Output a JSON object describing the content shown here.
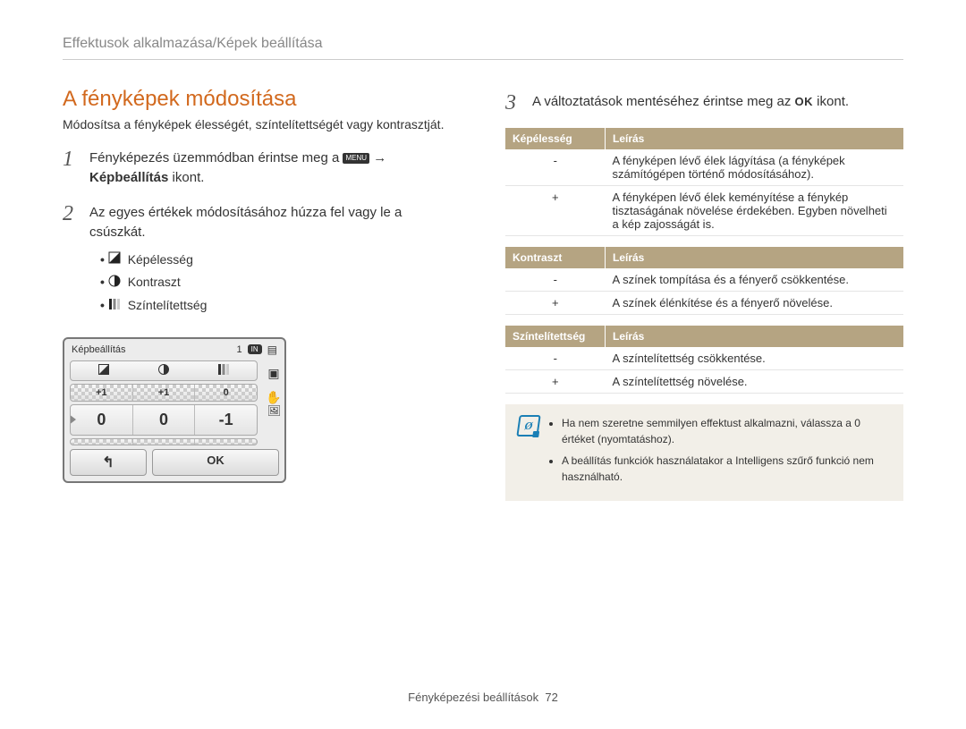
{
  "breadcrumb": "Effektusok alkalmazása/Képek beállítása",
  "title": "A fényképek módosítása",
  "intro": "Módosítsa a fényképek élességét, színtelítettségét vagy kontrasztját.",
  "steps": {
    "s1_pre": "Fényképezés üzemmódban érintse meg a ",
    "s1_menu": "MENU",
    "s1_arrow": " →",
    "s1_post_bold": "Képbeállítás",
    "s1_post_after": " ikont.",
    "s2": "Az egyes értékek módosításához húzza fel vagy le a csúszkát.",
    "s3_pre": "A változtatások mentéséhez érintse meg az ",
    "s3_ok": "OK",
    "s3_post": " ikont."
  },
  "bullets": {
    "b1": "Képélesség",
    "b2": "Kontraszt",
    "b3": "Színtelítettség"
  },
  "shot": {
    "title": "Képbeállítás",
    "counter": "1",
    "pill": "IN",
    "r1": [
      "+1",
      "+1",
      "0"
    ],
    "r2": [
      "0",
      "0",
      "-1"
    ],
    "r3": [
      "",
      "",
      ""
    ],
    "ok": "OK",
    "back": "↰"
  },
  "tables": {
    "t1": {
      "h1": "Képélesség",
      "h2": "Leírás",
      "rows": [
        {
          "k": "-",
          "v": "A fényképen lévő élek lágyítása (a fényképek számítógépen történő módosításához)."
        },
        {
          "k": "+",
          "v": "A fényképen lévő élek keményítése a fénykép tisztaságának növelése érdekében. Egyben növelheti a kép zajosságát is."
        }
      ]
    },
    "t2": {
      "h1": "Kontraszt",
      "h2": "Leírás",
      "rows": [
        {
          "k": "-",
          "v": "A színek tompítása és a fényerő csökkentése."
        },
        {
          "k": "+",
          "v": "A színek élénkítése és a fényerő növelése."
        }
      ]
    },
    "t3": {
      "h1": "Színtelítettség",
      "h2": "Leírás",
      "rows": [
        {
          "k": "-",
          "v": "A színtelítettség csökkentése."
        },
        {
          "k": "+",
          "v": "A színtelítettség növelése."
        }
      ]
    }
  },
  "note": {
    "n1": "Ha nem szeretne semmilyen effektust alkalmazni, válassza a 0 értéket (nyomtatáshoz).",
    "n2": "A beállítás funkciók használatakor a Intelligens szűrő funkció nem használható."
  },
  "footer": {
    "label": "Fényképezési beállítások",
    "page": "72"
  }
}
